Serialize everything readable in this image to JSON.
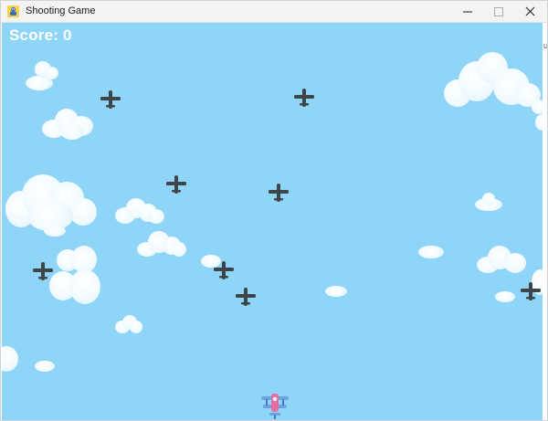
{
  "window": {
    "title": "Shooting Game"
  },
  "titlebar_ghost_text": "",
  "hud": {
    "score_label": "Score: 0"
  },
  "edge_text": "u",
  "colors": {
    "sky": "#8ed5f7",
    "enemy": "#3e4448",
    "player_wing": "#6aa3e6",
    "player_body": "#e86a9e"
  },
  "icons": {
    "app": "python-game-icon",
    "minimize": "minimize-icon",
    "maximize": "maximize-icon",
    "close": "close-icon",
    "enemy": "enemy-plane-icon",
    "player": "player-biplane-icon"
  }
}
